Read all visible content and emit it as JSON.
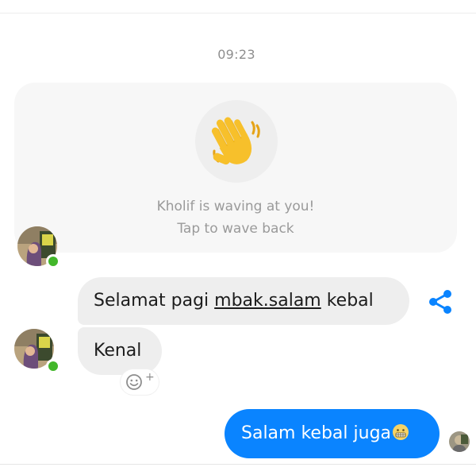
{
  "conversation": {
    "timestamp": "09:23"
  },
  "wave_card": {
    "icon": "waving-hand-icon",
    "line1": "Kholif is waving at you!",
    "line2": "Tap to wave back"
  },
  "messages": [
    {
      "direction": "incoming",
      "text_before": "Selamat pagi ",
      "text_link": "mbak.salam",
      "text_after": " kebal"
    },
    {
      "direction": "incoming",
      "text": "Kenal"
    },
    {
      "direction": "outgoing",
      "text": "Salam kebal juga",
      "emoji": "grimacing-face-icon"
    }
  ],
  "actions": {
    "share_icon": "share-icon",
    "react_icon": "add-reaction-icon",
    "react_plus": "+"
  },
  "colors": {
    "outgoing_bubble": "#0a84ff",
    "incoming_bubble": "#eeeeee",
    "presence": "#42b72a",
    "accent": "#0a84ff",
    "wave_hand": "#f7c02b"
  }
}
